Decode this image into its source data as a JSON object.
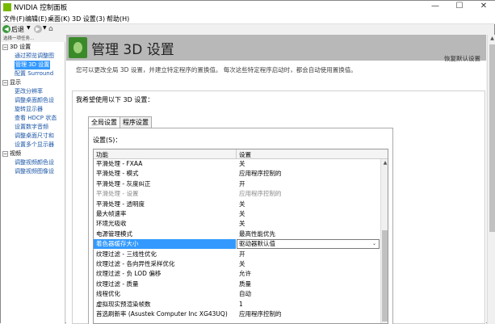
{
  "window": {
    "title": "NVIDIA 控制面板",
    "minimize": "—",
    "maximize": "☐",
    "close": "✕"
  },
  "menu": [
    "文件(F)",
    "编辑(E)",
    "桌面(K)",
    "3D 设置(3)",
    "帮助(H)"
  ],
  "toolbar": {
    "back_label": "后退",
    "back_icon": "back-arrow-icon",
    "forward_icon": "forward-arrow-icon",
    "home_icon": "home-icon"
  },
  "task_header": "选择一项任务...",
  "sidebar": {
    "groups": [
      {
        "label": "3D 设置",
        "items": [
          "通过预览调整图",
          "管理 3D 设置",
          "配置 Surround"
        ],
        "selected_index": 1
      },
      {
        "label": "显示",
        "items": [
          "更改分辨率",
          "调整桌面颜色设",
          "旋转显示器",
          "查看 HDCP 状态",
          "设置数字音频",
          "调整桌面尺寸和",
          "设置多个显示器"
        ]
      },
      {
        "label": "视频",
        "items": [
          "调整视频颜色设",
          "调整视频图像设"
        ]
      }
    ]
  },
  "page": {
    "title": "管理 3D 设置",
    "restore_defaults": "恢复默认设置",
    "description": "您可以更改全局 3D 设置，并建立特定程序的置换值。 每次这些特定程序启动时，都会自动使用置换值。",
    "preference_label": "我希望使用以下 3D 设置：",
    "tabs": [
      {
        "label": "全局设置",
        "active": true
      },
      {
        "label": "程序设置",
        "active": false
      }
    ],
    "settings_label": "设置(S)：",
    "columns": [
      "功能",
      "设置"
    ],
    "rows": [
      {
        "feature": "平滑处理 - FXAA",
        "value": "关"
      },
      {
        "feature": "平滑处理 - 模式",
        "value": "应用程序控制的"
      },
      {
        "feature": "平滑处理 - 灰度纠正",
        "value": "开"
      },
      {
        "feature": "平滑处理 - 设置",
        "value": "应用程序控制的",
        "disabled": true
      },
      {
        "feature": "平滑处理 - 透明度",
        "value": "关"
      },
      {
        "feature": "最大帧速率",
        "value": "关"
      },
      {
        "feature": "环境光吸收",
        "value": "关"
      },
      {
        "feature": "电源管理模式",
        "value": "最高性能优先"
      },
      {
        "feature": "着色器缓存大小",
        "value": "驱动器默认值",
        "selected": true
      },
      {
        "feature": "纹理过滤 - 三线性优化",
        "value": "开"
      },
      {
        "feature": "纹理过滤 - 各向异性采样优化",
        "value": "关"
      },
      {
        "feature": "纹理过滤 - 负 LOD 偏移",
        "value": "允许"
      },
      {
        "feature": "纹理过滤 - 质量",
        "value": "质量"
      },
      {
        "feature": "线程优化",
        "value": "自动"
      },
      {
        "feature": "虚拟现实预渲染帧数",
        "value": "1"
      },
      {
        "feature": "首选刷新率 (Asustek Computer Inc XG43UQ)",
        "value": "应用程序控制的"
      }
    ]
  },
  "colors": {
    "selection": "#3399ff",
    "banner": "#b8b8b8",
    "nvidia_green": "#76b900",
    "link": "#1a55a6"
  }
}
